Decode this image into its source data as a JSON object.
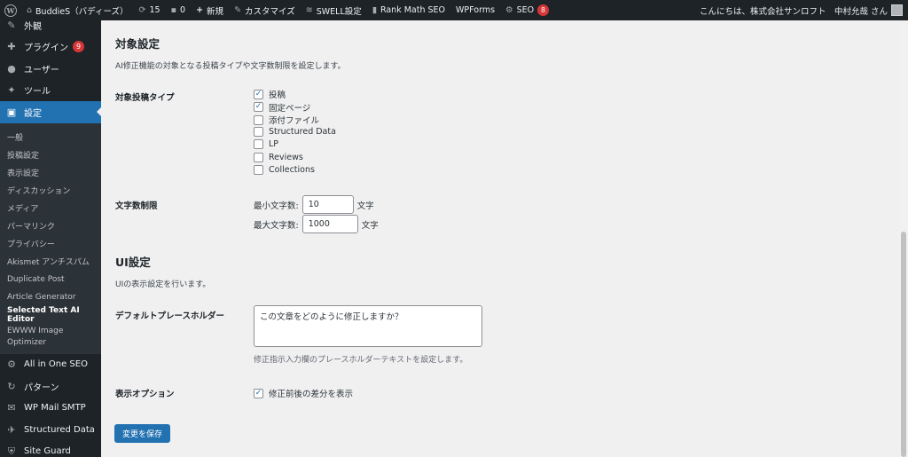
{
  "adminbar": {
    "site_name": "BuddieS（バディーズ）",
    "updates_count": "15",
    "comments_count": "0",
    "new_label": "新規",
    "customize_label": "カスタマイズ",
    "swell_label": "SWELL設定",
    "rankmath_label": "Rank Math SEO",
    "wpforms_label": "WPForms",
    "seo_label": "SEO",
    "seo_badge": "8",
    "greeting": "こんにちは、株式会社サンロフト　中村允哉 さん"
  },
  "sidebar": {
    "items_top": [
      {
        "label": "外観",
        "icon": "paintbrush-icon"
      },
      {
        "label": "プラグイン",
        "icon": "plugin-icon",
        "badge": "9"
      },
      {
        "label": "ユーザー",
        "icon": "user-icon"
      },
      {
        "label": "ツール",
        "icon": "wrench-icon"
      },
      {
        "label": "設定",
        "icon": "settings-icon"
      }
    ],
    "submenu": [
      "一般",
      "投稿設定",
      "表示設定",
      "ディスカッション",
      "メディア",
      "パーマリンク",
      "プライバシー",
      "Akismet アンチスパム",
      "Duplicate Post",
      "Article Generator",
      "Selected Text AI Editor",
      "EWWW Image Optimizer"
    ],
    "items_bottom": [
      {
        "label": "All in One SEO",
        "icon": "aioseo-icon"
      },
      {
        "label": "パターン",
        "icon": "pattern-icon"
      },
      {
        "label": "WP Mail SMTP",
        "icon": "mail-icon"
      },
      {
        "label": "Structured Data",
        "icon": "pin-icon"
      },
      {
        "label": "Site Guard",
        "icon": "shield-icon"
      }
    ]
  },
  "main": {
    "section1_title": "対象設定",
    "section1_desc": "AI修正機能の対象となる投稿タイプや文字数制限を設定します。",
    "post_types_label": "対象投稿タイプ",
    "post_types": [
      {
        "label": "投稿",
        "checked": true
      },
      {
        "label": "固定ページ",
        "checked": true
      },
      {
        "label": "添付ファイル",
        "checked": false
      },
      {
        "label": "Structured Data",
        "checked": false
      },
      {
        "label": "LP",
        "checked": false
      },
      {
        "label": "Reviews",
        "checked": false
      },
      {
        "label": "Collections",
        "checked": false
      }
    ],
    "char_limit_label": "文字数制限",
    "min_label": "最小文字数:",
    "min_value": "10",
    "max_label": "最大文字数:",
    "max_value": "1000",
    "unit": "文字",
    "section2_title": "UI設定",
    "section2_desc": "UIの表示設定を行います。",
    "placeholder_label": "デフォルトプレースホルダー",
    "placeholder_value": "この文章をどのように修正しますか？",
    "placeholder_help": "修正指示入力欄のプレースホルダーテキストを設定します。",
    "display_options_label": "表示オプション",
    "diff_option_label": "修正前後の差分を表示",
    "diff_option_checked": true,
    "save_label": "変更を保存"
  },
  "colors": {
    "accent": "#2271b1",
    "sidebar_bg": "#1d2327",
    "badge": "#d63638",
    "page_bg": "#f0f0f1"
  }
}
